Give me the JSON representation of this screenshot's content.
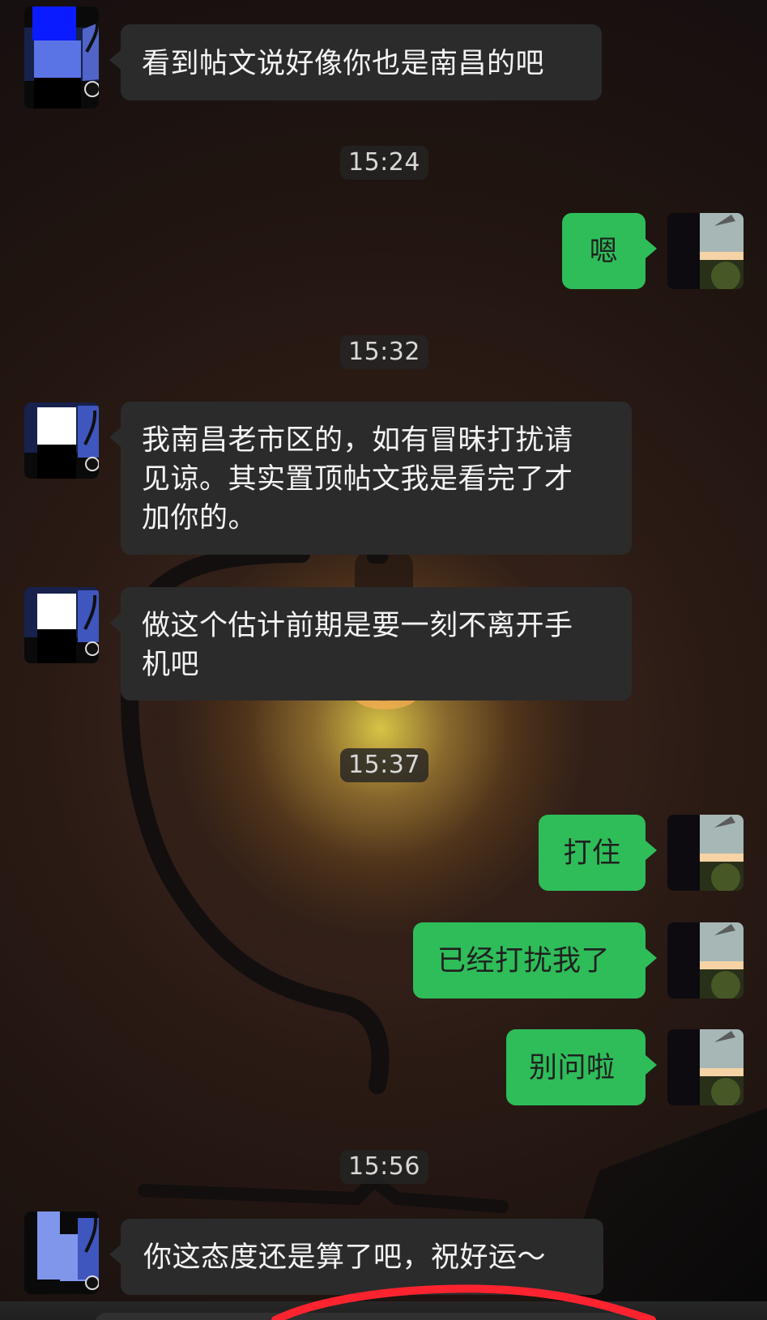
{
  "chat": {
    "messages": [
      {
        "id": "m1",
        "side": "left",
        "text": "看到帖文说好像你也是南昌的吧"
      },
      {
        "id": "t1",
        "type": "timestamp",
        "text": "15:24"
      },
      {
        "id": "m2",
        "side": "right",
        "text": "嗯"
      },
      {
        "id": "t2",
        "type": "timestamp",
        "text": "15:32"
      },
      {
        "id": "m3",
        "side": "left",
        "lines": [
          "我南昌老市区的，如有冒昧打扰请",
          "见谅。其实置顶帖文我是看完了才",
          "加你的。"
        ]
      },
      {
        "id": "m4",
        "side": "left",
        "lines": [
          "做这个估计前期是要一刻不离开手",
          "机吧"
        ]
      },
      {
        "id": "t3",
        "type": "timestamp",
        "text": "15:37"
      },
      {
        "id": "m5",
        "side": "right",
        "text": "打住"
      },
      {
        "id": "m6",
        "side": "right",
        "text": "已经打扰我了"
      },
      {
        "id": "m7",
        "side": "right",
        "text": "别问啦"
      },
      {
        "id": "t4",
        "type": "timestamp",
        "text": "15:56"
      },
      {
        "id": "m8",
        "side": "left",
        "text": "你这态度还是算了吧，祝好运～"
      }
    ]
  },
  "colors": {
    "left_bubble": "#2b2b2b",
    "right_bubble": "#2ebd59",
    "timestamp_bg": "#252525",
    "timestamp_text": "#d8d8d8",
    "left_text": "#f4f4f4",
    "right_text": "#202020"
  },
  "icons": {
    "left_avatar": "redacted-user-avatar-icon",
    "right_avatar": "sunset-avatar-icon"
  }
}
